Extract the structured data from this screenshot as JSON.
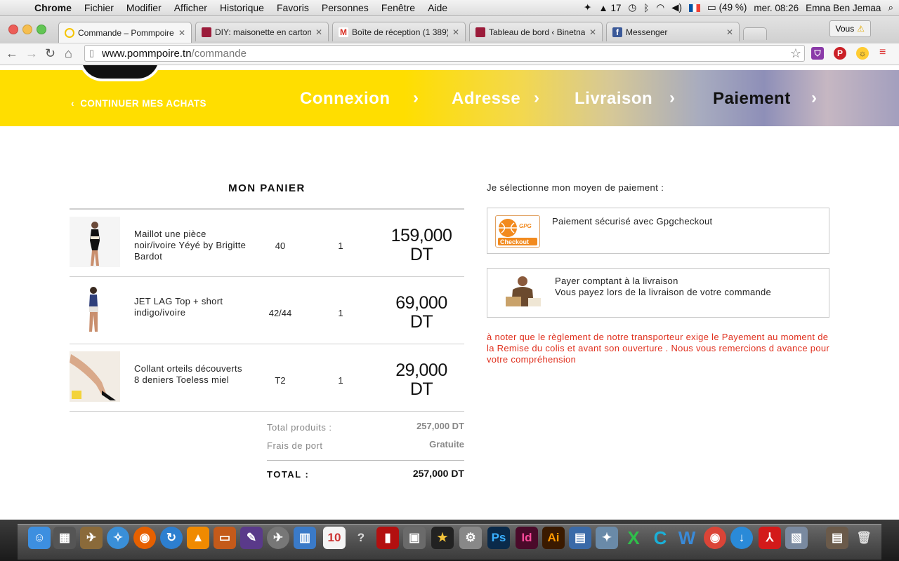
{
  "menubar": {
    "app": "Chrome",
    "items": [
      "Fichier",
      "Modifier",
      "Afficher",
      "Historique",
      "Favoris",
      "Personnes",
      "Fenêtre",
      "Aide"
    ],
    "battery": "(49 %)",
    "clock": "mer. 08:26",
    "user": "Emna Ben Jemaa",
    "adobe_count": "17"
  },
  "tabs": [
    {
      "title": "Commande – Pommpoire",
      "color": "#f5c400",
      "active": true
    },
    {
      "title": "DIY: maisonette en carton",
      "color": "#9b1b3a"
    },
    {
      "title": "Boîte de réception (1 389)",
      "color": "#d93025"
    },
    {
      "title": "Tableau de bord ‹ Binetna",
      "color": "#9b1b3a"
    },
    {
      "title": "Messenger",
      "color": "#3b5998"
    }
  ],
  "profile_button": "Vous",
  "address": {
    "host": "www.pommpoire.tn",
    "path": "/commande"
  },
  "checkout": {
    "continue_label": "CONTINUER MES ACHATS",
    "steps": [
      "Connexion",
      "Adresse",
      "Livraison",
      "Paiement"
    ],
    "current_step": "Paiement"
  },
  "cart": {
    "title": "MON PANIER",
    "items": [
      {
        "name": "Maillot une pièce noir/ivoire Yéyé by Brigitte Bardot",
        "size": "40",
        "qty": "1",
        "price_amount": "159,000",
        "currency": "DT"
      },
      {
        "name": "JET LAG Top + short indigo/ivoire",
        "size": "42/44",
        "qty": "1",
        "price_amount": "69,000",
        "currency": "DT"
      },
      {
        "name": "Collant orteils découverts 8 deniers Toeless miel",
        "size": "T2",
        "qty": "1",
        "price_amount": "29,000",
        "currency": "DT"
      }
    ],
    "total_products_label": "Total produits :",
    "total_products_value": "257,000 DT",
    "shipping_label": "Frais de port",
    "shipping_value": "Gratuite",
    "grand_total_label": "TOTAL :",
    "grand_total_value": "257,000 DT"
  },
  "payment": {
    "title": "Je sélectionne mon moyen de paiement :",
    "gpg_label": "Paiement sécurisé avec Gpgcheckout",
    "gpg_logo_top": "GPG",
    "gpg_logo_bottom": "Checkout",
    "cod_line1": "Payer comptant à la livraison",
    "cod_line2": "Vous payez lors de la livraison de votre commande",
    "note": "à noter que le règlement de notre transporteur exige le Payement au moment de la Remise du colis et avant son ouverture . Nous vous remercions d avance pour votre compréhension"
  },
  "colors": {
    "accent": "#ffde00",
    "note": "#e0301e"
  }
}
